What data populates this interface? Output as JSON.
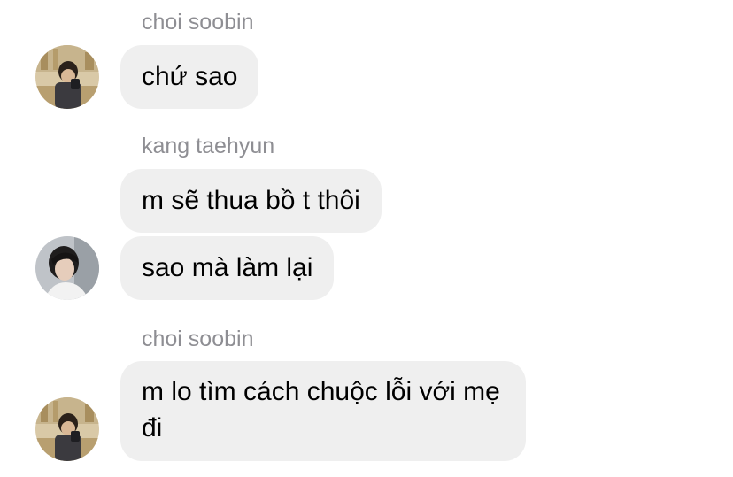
{
  "messages": [
    {
      "sender": "choi soobin",
      "text": "chứ sao"
    },
    {
      "sender": "kang taehyun",
      "texts": [
        "m sẽ thua bồ t thôi",
        "sao mà làm lại"
      ]
    },
    {
      "sender": "choi soobin",
      "text": "m lo tìm cách chuộc lỗi với mẹ đi"
    }
  ],
  "colors": {
    "bubble": "#efefef",
    "sender_name": "#8e8e93",
    "text": "#000000"
  },
  "icons": {
    "soobin_avatar": "user-avatar-photo",
    "taehyun_avatar": "user-avatar-photo"
  }
}
